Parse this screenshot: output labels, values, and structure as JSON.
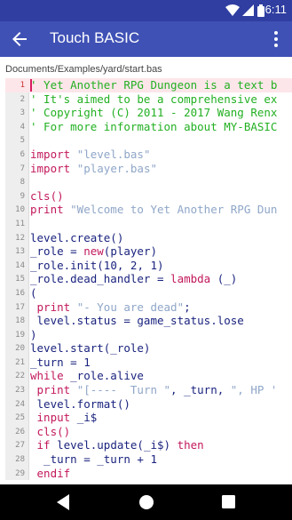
{
  "status_bar": {
    "time": "6:11",
    "icons": [
      "wifi-icon",
      "signal-icon",
      "battery-icon"
    ],
    "color": "#2f3ea0"
  },
  "app_bar": {
    "title": "Touch BASIC",
    "back_icon": "arrow-left-icon",
    "menu_icon": "more-vert-icon",
    "color": "#3f51b5"
  },
  "file_path": "Documents/Examples/yard/start.bas",
  "editor": {
    "current_line": 1,
    "colors": {
      "comment": "#22b022",
      "keyword": "#c2185b",
      "identifier": "#1a237e",
      "string": "#8fa6c8",
      "number": "#1a237e",
      "cursor": "#d81b60"
    },
    "lines": [
      {
        "num": "1",
        "tokens": [
          {
            "t": "' Yet Another RPG Dungeon is a text b",
            "c": "comment"
          }
        ]
      },
      {
        "num": "2",
        "tokens": [
          {
            "t": "' It's aimed to be a comprehensive ex",
            "c": "comment"
          }
        ]
      },
      {
        "num": "3",
        "tokens": [
          {
            "t": "' Copyright (C) 2011 - 2017 Wang Renx",
            "c": "comment"
          }
        ]
      },
      {
        "num": "4",
        "tokens": [
          {
            "t": "' For more information about MY-BASIC",
            "c": "comment"
          }
        ]
      },
      {
        "num": "5",
        "tokens": []
      },
      {
        "num": "6",
        "tokens": [
          {
            "t": "import ",
            "c": "keyword"
          },
          {
            "t": "\"level.bas\"",
            "c": "string"
          }
        ]
      },
      {
        "num": "7",
        "tokens": [
          {
            "t": "import ",
            "c": "keyword"
          },
          {
            "t": "\"player.bas\"",
            "c": "string"
          }
        ]
      },
      {
        "num": "8",
        "tokens": []
      },
      {
        "num": "9",
        "tokens": [
          {
            "t": "cls()",
            "c": "keyword"
          }
        ]
      },
      {
        "num": "10",
        "tokens": [
          {
            "t": "print ",
            "c": "keyword"
          },
          {
            "t": "\"Welcome to Yet Another RPG Dun",
            "c": "string"
          }
        ]
      },
      {
        "num": "11",
        "tokens": []
      },
      {
        "num": "12",
        "tokens": [
          {
            "t": "level.create()",
            "c": "identifier"
          }
        ]
      },
      {
        "num": "13",
        "tokens": [
          {
            "t": "_role = ",
            "c": "identifier"
          },
          {
            "t": "new",
            "c": "keyword"
          },
          {
            "t": "(player)",
            "c": "identifier"
          }
        ]
      },
      {
        "num": "14",
        "tokens": [
          {
            "t": "_role.init(",
            "c": "identifier"
          },
          {
            "t": "10",
            "c": "number"
          },
          {
            "t": ", ",
            "c": "identifier"
          },
          {
            "t": "2",
            "c": "number"
          },
          {
            "t": ", ",
            "c": "identifier"
          },
          {
            "t": "1",
            "c": "number"
          },
          {
            "t": ")",
            "c": "identifier"
          }
        ]
      },
      {
        "num": "15",
        "tokens": [
          {
            "t": "_role.dead_handler = ",
            "c": "identifier"
          },
          {
            "t": "lambda",
            "c": "keyword"
          },
          {
            "t": " (_)",
            "c": "identifier"
          }
        ]
      },
      {
        "num": "16",
        "tokens": [
          {
            "t": "(",
            "c": "identifier"
          }
        ]
      },
      {
        "num": "17",
        "tokens": [
          {
            "t": " print ",
            "c": "keyword"
          },
          {
            "t": "\"- You are dead\"",
            "c": "string"
          },
          {
            "t": ";",
            "c": "identifier"
          }
        ]
      },
      {
        "num": "18",
        "tokens": [
          {
            "t": " level.status = game_status.lose",
            "c": "identifier"
          }
        ]
      },
      {
        "num": "19",
        "tokens": [
          {
            "t": ")",
            "c": "identifier"
          }
        ]
      },
      {
        "num": "20",
        "tokens": [
          {
            "t": "level.start(_role)",
            "c": "identifier"
          }
        ]
      },
      {
        "num": "21",
        "tokens": [
          {
            "t": "_turn = ",
            "c": "identifier"
          },
          {
            "t": "1",
            "c": "number"
          }
        ]
      },
      {
        "num": "22",
        "tokens": [
          {
            "t": "while ",
            "c": "keyword"
          },
          {
            "t": "_role.alive",
            "c": "identifier"
          }
        ]
      },
      {
        "num": "23",
        "tokens": [
          {
            "t": " print ",
            "c": "keyword"
          },
          {
            "t": "\"[----  Turn \"",
            "c": "string"
          },
          {
            "t": ", _turn, ",
            "c": "identifier"
          },
          {
            "t": "\", HP '",
            "c": "string"
          }
        ]
      },
      {
        "num": "24",
        "tokens": [
          {
            "t": " level.format()",
            "c": "identifier"
          }
        ]
      },
      {
        "num": "25",
        "tokens": [
          {
            "t": " input ",
            "c": "keyword"
          },
          {
            "t": "_i$",
            "c": "identifier"
          }
        ]
      },
      {
        "num": "26",
        "tokens": [
          {
            "t": " cls()",
            "c": "keyword"
          }
        ]
      },
      {
        "num": "27",
        "tokens": [
          {
            "t": " if ",
            "c": "keyword"
          },
          {
            "t": "level.update(_i$) ",
            "c": "identifier"
          },
          {
            "t": "then",
            "c": "keyword"
          }
        ]
      },
      {
        "num": "28",
        "tokens": [
          {
            "t": "  _turn = _turn + ",
            "c": "identifier"
          },
          {
            "t": "1",
            "c": "number"
          }
        ]
      },
      {
        "num": "29",
        "tokens": [
          {
            "t": " endif",
            "c": "keyword"
          }
        ]
      }
    ]
  },
  "nav_bar": {
    "icons": [
      "back-triangle-icon",
      "home-circle-icon",
      "recents-square-icon"
    ]
  }
}
